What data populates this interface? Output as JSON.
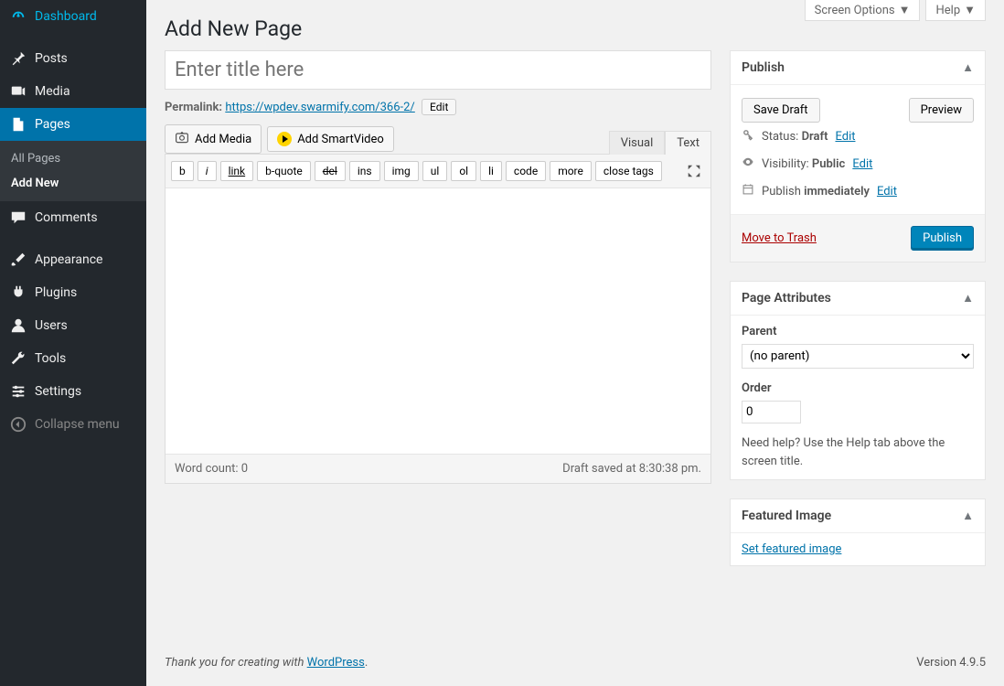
{
  "screen": {
    "options": "Screen Options",
    "help": "Help"
  },
  "heading": "Add New Page",
  "sidebar": {
    "items": [
      {
        "label": "Dashboard"
      },
      {
        "label": "Posts"
      },
      {
        "label": "Media"
      },
      {
        "label": "Pages"
      },
      {
        "label": "Comments"
      },
      {
        "label": "Appearance"
      },
      {
        "label": "Plugins"
      },
      {
        "label": "Users"
      },
      {
        "label": "Tools"
      },
      {
        "label": "Settings"
      }
    ],
    "pages_sub": [
      {
        "label": "All Pages"
      },
      {
        "label": "Add New"
      }
    ],
    "collapse": "Collapse menu"
  },
  "title": {
    "placeholder": "Enter title here",
    "permalink_label": "Permalink:",
    "permalink_url": "https://wpdev.swarmify.com/366-2/",
    "edit": "Edit"
  },
  "media": {
    "add_media": "Add Media",
    "add_smartvideo": "Add SmartVideo"
  },
  "tabs": {
    "visual": "Visual",
    "text": "Text"
  },
  "quicktags": [
    "b",
    "i",
    "link",
    "b-quote",
    "del",
    "ins",
    "img",
    "ul",
    "ol",
    "li",
    "code",
    "more",
    "close tags"
  ],
  "editor": {
    "word_count_label": "Word count:",
    "word_count": "0",
    "save_notice": "Draft saved at 8:30:38 pm."
  },
  "publish": {
    "title": "Publish",
    "save_draft": "Save Draft",
    "preview": "Preview",
    "status_label": "Status:",
    "status_value": "Draft",
    "visibility_label": "Visibility:",
    "visibility_value": "Public",
    "schedule_label": "Publish",
    "schedule_value": "immediately",
    "edit": "Edit",
    "trash": "Move to Trash",
    "publish_btn": "Publish"
  },
  "attributes": {
    "title": "Page Attributes",
    "parent_label": "Parent",
    "parent_value": "(no parent)",
    "order_label": "Order",
    "order_value": "0",
    "help_text": "Need help? Use the Help tab above the screen title."
  },
  "featured": {
    "title": "Featured Image",
    "link": "Set featured image"
  },
  "footer": {
    "thank_prefix": "Thank you for creating with ",
    "wp": "WordPress",
    "dot": ".",
    "version": "Version 4.9.5"
  }
}
